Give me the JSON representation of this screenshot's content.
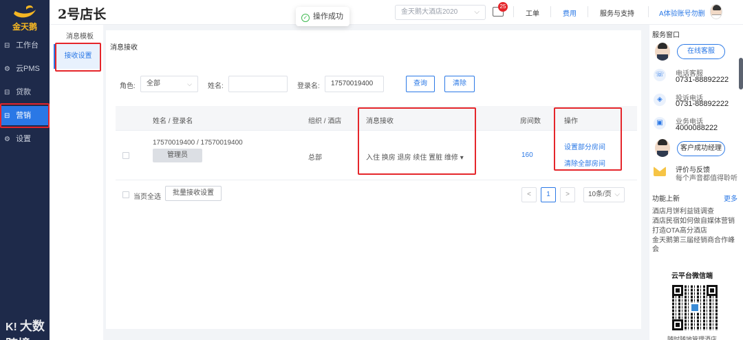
{
  "app": {
    "logo_text": "金天鹅",
    "store_title": "2号店长",
    "watermark": "大数跨境",
    "watermark_mark": "K!"
  },
  "nav": {
    "items": [
      {
        "icon": "⊟",
        "label": "工作台"
      },
      {
        "icon": "⚙",
        "label": "云PMS"
      },
      {
        "icon": "⊟",
        "label": "贷款"
      },
      {
        "icon": "⊟",
        "label": "营销"
      },
      {
        "icon": "⚙",
        "label": "设置"
      }
    ]
  },
  "header": {
    "toast": "操作成功",
    "hotel_placeholder": "金天鹅大酒店2020",
    "mail_badge": "25",
    "links": [
      "工单",
      "费用",
      "服务与支持"
    ],
    "account": "A体验账号勿删"
  },
  "submenu": {
    "parent": "消息模板",
    "active": "接收设置"
  },
  "main": {
    "title": "消息接收",
    "filter": {
      "role_label": "角色:",
      "role_value": "全部",
      "name_label": "姓名:",
      "name_value": "",
      "login_label": "登录名:",
      "login_value": "17570019400",
      "query_button": "查询",
      "clear_button": "清除"
    },
    "table": {
      "columns": [
        "姓名 / 登录名",
        "组织 / 酒店",
        "消息接收",
        "房间数",
        "操作"
      ],
      "rows": [
        {
          "name_login": "17570019400 / 17570019400",
          "role": "管理员",
          "org": "总部",
          "messages": "入住 换房 退房 续住 置脏 维修",
          "rooms": "160",
          "action_partial": "设置部分房间",
          "action_clear": "清除全部房间"
        }
      ]
    },
    "footer": {
      "select_all": "当页全选",
      "batch_button": "批量接收设置",
      "prev": "<",
      "current_page": "1",
      "next": ">",
      "page_size": "10条/页"
    }
  },
  "right_panel": {
    "title": "服务窗口",
    "online_service": "在线客服",
    "hotline_label": "电话客服",
    "hotline_value": "0731-88892222",
    "complaint_label": "投诉电话",
    "complaint_value": "0731-88892222",
    "business_label": "业务电话",
    "business_value": "4000088222",
    "manager_button": "客户成功经理",
    "feedback_title": "评价与反馈",
    "feedback_sub": "每个声音都值得聆听",
    "news_title": "功能上新",
    "news_more": "更多",
    "news": [
      "酒店月饼利益链调查",
      "酒店民宿如何做自媒体营销",
      "打造OTA高分酒店",
      "金天鹅第三届经销商合作峰会"
    ],
    "qr_title": "云平台微信端",
    "qr_caption": "随时随地管理酒店"
  },
  "colors": {
    "primary": "#2a78e6",
    "nav_bg": "#1e2a4a",
    "highlight_red": "#e5252a"
  }
}
